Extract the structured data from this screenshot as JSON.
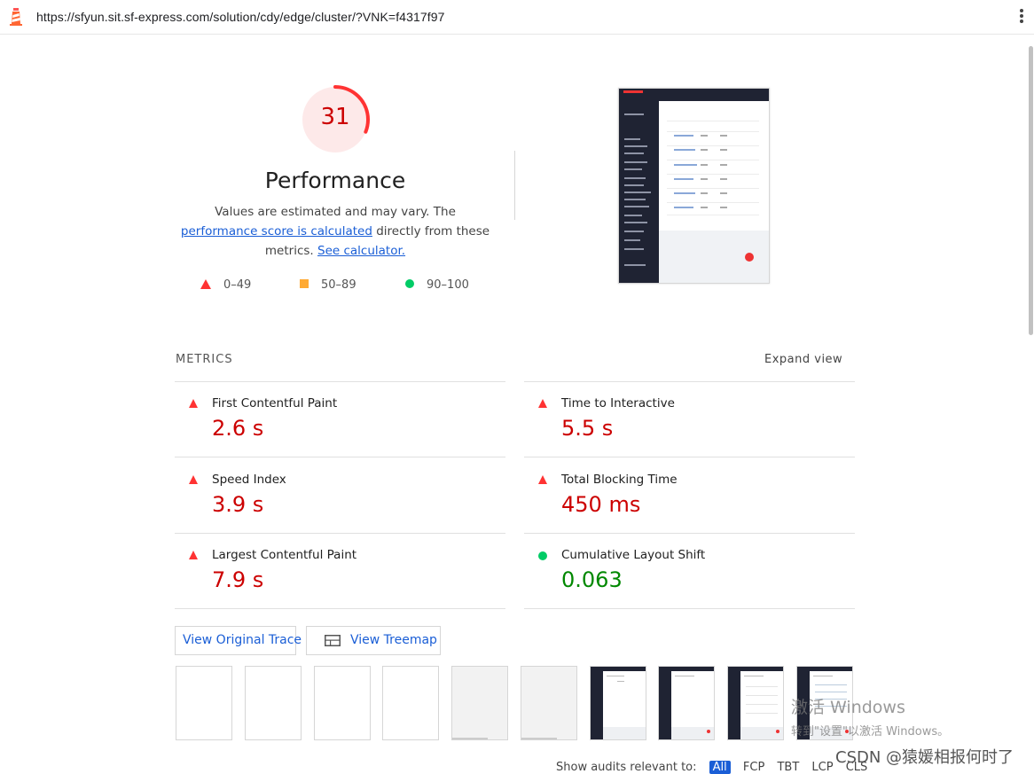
{
  "browser": {
    "url": "https://sfyun.sit.sf-express.com/solution/cdy/edge/cluster/?VNK=f4317f97",
    "icons": {
      "site": "lighthouse-icon",
      "menu": "more-vert-icon"
    }
  },
  "category": {
    "score": "31",
    "score_fraction": 0.31,
    "title": "Performance",
    "description_prefix": "Values are estimated and may vary. The ",
    "description_link1": "performance score is calculated",
    "description_middle": " directly from these metrics. ",
    "description_link2": "See calculator.",
    "legend": [
      {
        "range": "0–49",
        "shape": "triangle",
        "color": "#ff3333"
      },
      {
        "range": "50–89",
        "shape": "square",
        "color": "#ffaa33"
      },
      {
        "range": "90–100",
        "shape": "circle",
        "color": "#00cc66"
      }
    ],
    "gauge_color": "#ff3333"
  },
  "metrics": {
    "header": "METRICS",
    "expand": "Expand view",
    "items": [
      {
        "title": "First Contentful Paint",
        "value": "2.6 s",
        "status": "fail"
      },
      {
        "title": "Time to Interactive",
        "value": "5.5 s",
        "status": "fail"
      },
      {
        "title": "Speed Index",
        "value": "3.9 s",
        "status": "fail"
      },
      {
        "title": "Total Blocking Time",
        "value": "450 ms",
        "status": "fail"
      },
      {
        "title": "Largest Contentful Paint",
        "value": "7.9 s",
        "status": "fail"
      },
      {
        "title": "Cumulative Layout Shift",
        "value": "0.063",
        "status": "pass"
      }
    ]
  },
  "buttons": {
    "trace": "View Original Trace",
    "treemap": "View Treemap"
  },
  "filters": {
    "label": "Show audits relevant to:",
    "chips": [
      "All",
      "FCP",
      "TBT",
      "LCP",
      "CLS"
    ],
    "active": "All"
  },
  "watermark": {
    "line1": "激活 Windows",
    "line2": "转到\"设置\"以激活 Windows。"
  },
  "csdn": "CSDN @猿媛相报何时了"
}
